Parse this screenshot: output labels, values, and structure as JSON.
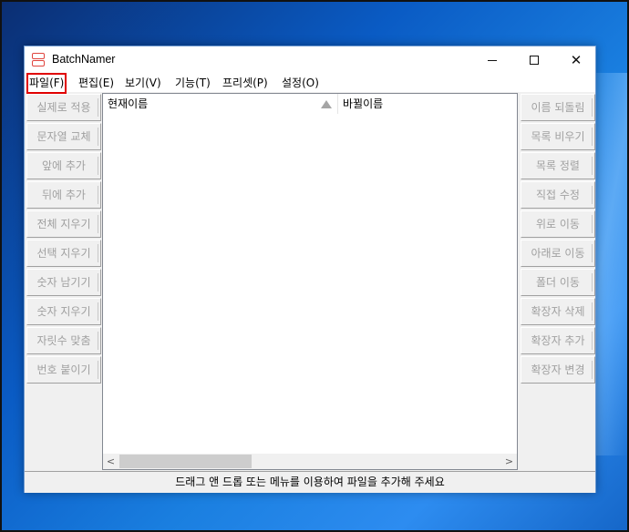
{
  "window": {
    "title": "BatchNamer",
    "controls": {
      "minimize": "minimize-icon",
      "maximize": "maximize-icon",
      "close": "✕"
    }
  },
  "menu": [
    {
      "label": "파일(F)",
      "highlighted": true
    },
    {
      "label": "편집(E)"
    },
    {
      "label": "보기(V)"
    },
    {
      "label": "기능(T)"
    },
    {
      "label": "프리셋(P)"
    },
    {
      "label": "설정(O)"
    }
  ],
  "left_buttons": [
    "실제로 적용",
    "문자열 교체",
    "앞에 추가",
    "뒤에 추가",
    "전체 지우기",
    "선택 지우기",
    "숫자 남기기",
    "숫자 지우기",
    "자릿수 맞춤",
    "번호 붙이기"
  ],
  "right_buttons": [
    "이름 되돌림",
    "목록 비우기",
    "목록 정렬",
    "직접 수정",
    "위로 이동",
    "아래로 이동",
    "폴더 이동",
    "확장자 삭제",
    "확장자 추가",
    "확장자 변경"
  ],
  "list": {
    "columns": [
      "현재이름",
      "바뀔이름"
    ],
    "sort_icon": "sort-up-icon",
    "scroll_left": "<",
    "scroll_right": ">"
  },
  "status": "드래그 앤 드롭 또는 메뉴를 이용하여 파일을 추가해 주세요",
  "colors": {
    "highlight": "#e00000",
    "disabled_text": "#a0a0a0",
    "app_icon": "#e0453e"
  }
}
